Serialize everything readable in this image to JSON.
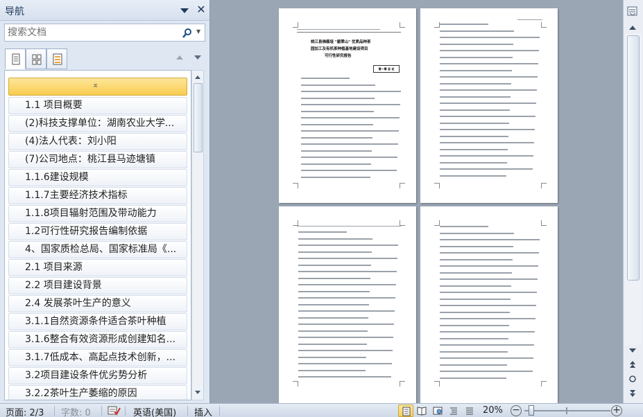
{
  "nav_pane": {
    "title": "导航",
    "search_placeholder": "搜索文档",
    "items": [
      "1.1 项目概要",
      "(2)科技支撑单位：湖南农业大学...",
      "(4)法人代表：刘小阳",
      "(7)公司地点：桃江县马迹塘镇",
      "1.1.6建设规模",
      "1.1.7主要经济技术指标",
      "1.1.8项目辐射范围及带动能力",
      "1.2可行性研究报告编制依据",
      "4、国家质检总局、国家标准局《...",
      "2.1 项目来源",
      "2.2 项目建设背景",
      "2.4 发展茶叶生产的意义",
      "3.1.1自然资源条件适合茶叶种植",
      "3.1.6整合有效资源形成创建知名...",
      "3.1.7低成本、高起点技术创新，...",
      "3.2项目建设条件优劣势分析",
      "3.2.2茶叶生产萎缩的原因"
    ]
  },
  "document": {
    "page1_title_lines": [
      "桃江县佛籁垭 \"碧翠山\" 优质品种茶",
      "园加工及有机茶种植基地建设项目",
      "可行性研究报告"
    ],
    "page1_box": "第一章 总 论"
  },
  "status_bar": {
    "page": "页面: 2/3",
    "word_count": "字数: 0",
    "language": "英语(美国)",
    "insert_mode": "插入",
    "zoom": "20%"
  },
  "colors": {
    "workspace": "#9ba6b5",
    "nav_bg": "#dfe7f2",
    "selected_item": "#f8cc50"
  }
}
